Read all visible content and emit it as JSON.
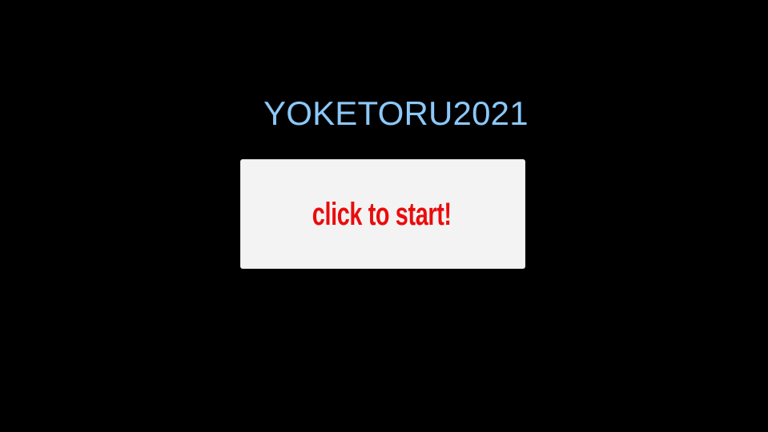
{
  "game": {
    "title": "YOKETORU2021",
    "start_label": "click to start!"
  },
  "colors": {
    "background": "#000000",
    "title": "#8cc8f8",
    "button_background": "#f3f3f3",
    "button_text": "#ea0c0c"
  }
}
